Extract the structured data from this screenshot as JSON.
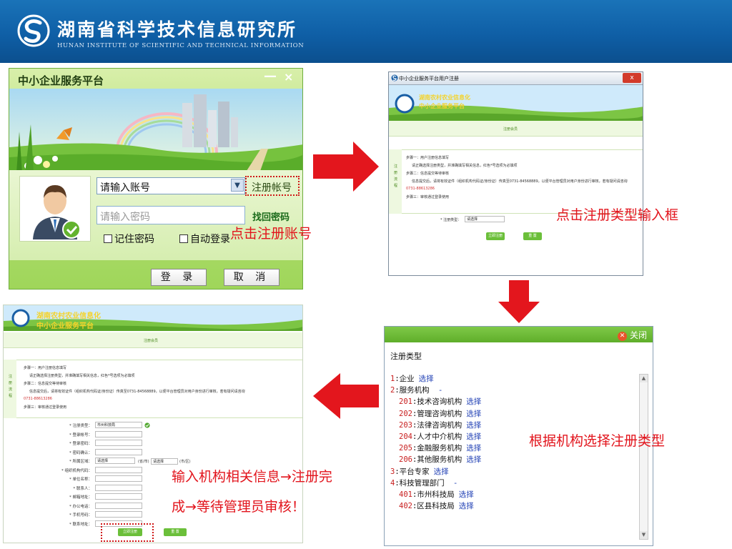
{
  "header": {
    "institute_name": "湖南省科学技术信息研究所",
    "institute_english": "HUNAN INSTITUTE OF SCIENTIFIC AND TECHNICAL INFORMATION"
  },
  "login_window": {
    "title": "中小企业服务平台",
    "minimize": "—",
    "close": "×",
    "account_placeholder": "请输入账号",
    "register_link": "注册帐号",
    "password_placeholder": "请输入密码",
    "find_password": "找回密码",
    "remember": "记住密码",
    "auto_login": "自动登录",
    "login_button": "登 录",
    "cancel_button": "取 消"
  },
  "captions": {
    "click_register": "点击注册账号",
    "click_type_input": "点击注册类型输入框",
    "choose_type": "根据机构选择注册类型",
    "fill_info_line1": "输入机构相关信息→注册完",
    "fill_info_line2": "成→等待管理员审核！"
  },
  "reg_window": {
    "title": "中小企业服务平台用户注册",
    "close": "x",
    "banner_line1": "湖南农村农业信息化",
    "banner_line2": "中小企业服务平台",
    "notice_heading": "注册会员",
    "side_label": "注册流程",
    "steps": [
      "步骤一：用户注册信息填写",
      "请正确选择注册类型，并准确填写相关信息，红色*号选项为必填项",
      "步骤二：信息提交等待审核",
      "信息提交后，请将有效证件（组织机构代码证/身份证）传真至0731-84568889，以便平台管理员对用户身份进行审核，若有疑问请咨询",
      "0731-88613286",
      "步骤三：审核通过登录使用"
    ],
    "type_label": "* 注册类型：",
    "type_value": "请选择",
    "submit": "立即注册",
    "reset": "重 置"
  },
  "type_dialog": {
    "close": "关闭",
    "heading": "注册类型",
    "select_label": "选择",
    "items": [
      {
        "code": "1",
        "name": "企业",
        "level": 0,
        "selectable": true
      },
      {
        "code": "2",
        "name": "服务机构",
        "level": 0,
        "selectable": false,
        "suffix": " -"
      },
      {
        "code": "201",
        "name": "技术咨询机构",
        "level": 1,
        "selectable": true
      },
      {
        "code": "202",
        "name": "管理咨询机构",
        "level": 1,
        "selectable": true
      },
      {
        "code": "203",
        "name": "法律咨询机构",
        "level": 1,
        "selectable": true
      },
      {
        "code": "204",
        "name": "人才中介机构",
        "level": 1,
        "selectable": true
      },
      {
        "code": "205",
        "name": "金融服务机构",
        "level": 1,
        "selectable": true
      },
      {
        "code": "206",
        "name": "其他服务机构",
        "level": 1,
        "selectable": true
      },
      {
        "code": "3",
        "name": "平台专家",
        "level": 0,
        "selectable": true
      },
      {
        "code": "4",
        "name": "科技管理部门",
        "level": 0,
        "selectable": false,
        "suffix": " -"
      },
      {
        "code": "401",
        "name": "市州科技局",
        "level": 1,
        "selectable": true
      },
      {
        "code": "402",
        "name": "区县科技局",
        "level": 1,
        "selectable": true
      }
    ]
  },
  "form_window": {
    "banner_line1": "湖南农村农业信息化",
    "banner_line2": "中小企业服务平台",
    "notice_heading": "注册会员",
    "side_label": "注册流程",
    "steps": [
      "步骤一：用户注册信息填写",
      "请正确选择注册类型，并准确填写相关信息，红色*号选项为必填项",
      "步骤二：信息提交等待审核",
      "信息提交后，请将有效证件（组织机构代码证/身份证）传真至0731-84568889，以便平台管理员对用户身份进行审核，若有疑问请咨询",
      "0731-88613286",
      "步骤三：审核通过登录使用"
    ],
    "fields": [
      {
        "label": "* 注册类型：",
        "value": "市州科技局"
      },
      {
        "label": "* 登录帐号：",
        "value": ""
      },
      {
        "label": "* 登录密码：",
        "value": ""
      },
      {
        "label": "* 密码确认：",
        "value": ""
      },
      {
        "label": "* 所属区域：",
        "value": "请选择"
      },
      {
        "label": "* 组织机构代码：",
        "value": ""
      },
      {
        "label": "* 单位名称：",
        "value": ""
      },
      {
        "label": "* 联系人：",
        "value": ""
      },
      {
        "label": "* 邮箱地址：",
        "value": ""
      },
      {
        "label": "* 办公电话：",
        "value": ""
      },
      {
        "label": "* 手机号码：",
        "value": ""
      },
      {
        "label": "* 联系地址：",
        "value": ""
      }
    ],
    "region_extra": "请选择",
    "region_unit1": "(省/市)",
    "region_unit2": "(市/区)",
    "submit": "立即注册",
    "reset": "重 置"
  },
  "colors": {
    "header_blue": "#0f5fa6",
    "caption_red": "#e2141c",
    "arrow_red": "#e3161d",
    "green": "#6bbf3a"
  }
}
